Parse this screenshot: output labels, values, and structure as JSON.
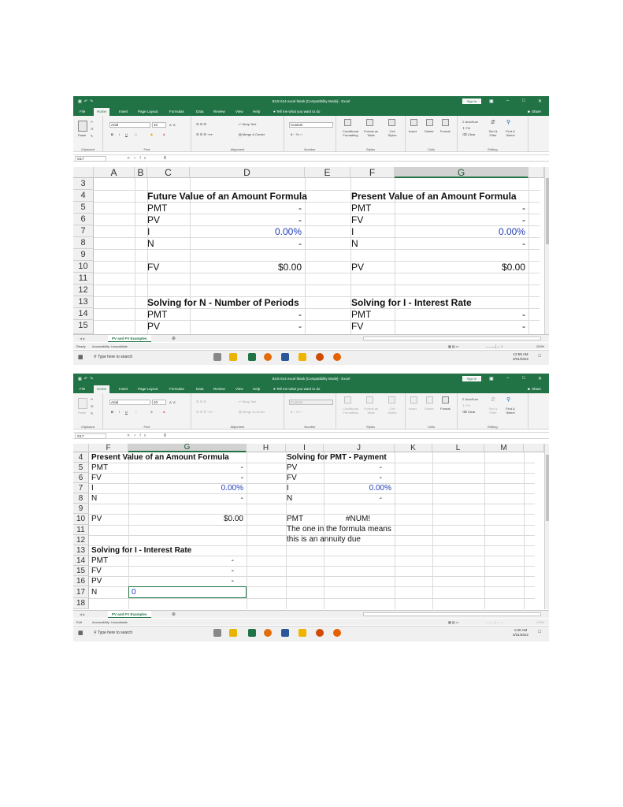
{
  "excel": {
    "title": "BUS 614 excel blank [Compatibility Mode] - Excel",
    "sign_in": "Sign in",
    "tabs": [
      "File",
      "Home",
      "Insert",
      "Page Layout",
      "Formulas",
      "Data",
      "Review",
      "View",
      "Help"
    ],
    "tell_me": "Tell me what you want to do",
    "share": "Share",
    "ribbon": {
      "paste": "Paste",
      "font_name": "Arial",
      "font_size": "10",
      "wrap_text": "Wrap Text",
      "merge_center": "Merge & Center",
      "number_format": "Custom",
      "conditional_formatting": "Conditional Formatting",
      "format_as_table": "Format as Table",
      "cell_styles": "Cell Styles",
      "insert": "Insert",
      "delete": "Delete",
      "format": "Format",
      "autosum": "AutoSum",
      "fill": "Fill",
      "clear": "Clear",
      "sort_filter": "Sort & Filter",
      "find_select": "Find & Select",
      "groups": [
        "Clipboard",
        "Font",
        "Alignment",
        "Number",
        "Styles",
        "Cells",
        "Editing"
      ]
    },
    "sheet_tab": "PV and FV Examples",
    "accessibility": "Accessibility: Unavailable",
    "taskbar_search": "Type here to search",
    "icons": [
      "save-icon",
      "undo-icon",
      "redo-icon",
      "minimize-icon",
      "restore-icon",
      "close-icon",
      "windows-start-icon",
      "search-icon",
      "task-view-icon",
      "file-explorer-icon",
      "excel-icon",
      "chrome-icon",
      "word-icon",
      "powerpoint-icon",
      "firefox-icon",
      "notification-icon"
    ]
  },
  "shot1": {
    "name_box": "G17",
    "formula": "0",
    "columns": [
      "A",
      "B",
      "C",
      "D",
      "E",
      "F",
      "G"
    ],
    "rows": [
      "3",
      "4",
      "5",
      "6",
      "7",
      "8",
      "9",
      "10",
      "11",
      "12",
      "13",
      "14",
      "15"
    ],
    "left_block": {
      "title": "Future Value of an Amount Formula",
      "labels": [
        "PMT",
        "PV",
        "I",
        "N",
        "FV"
      ],
      "values": [
        "-",
        "-",
        "0.00%",
        "-",
        "$0.00"
      ]
    },
    "right_block": {
      "title": "Present Value of an Amount Formula",
      "labels": [
        "PMT",
        "FV",
        "I",
        "N",
        "PV"
      ],
      "values": [
        "-",
        "-",
        "0.00%",
        "-",
        "$0.00"
      ]
    },
    "left_block2": {
      "title": "Solving for N - Number of Periods",
      "labels": [
        "PMT",
        "PV"
      ]
    },
    "right_block2": {
      "title": "Solving for I - Interest Rate",
      "labels": [
        "PMT",
        "FV"
      ],
      "values": [
        "-",
        "-"
      ]
    },
    "status": "Ready",
    "zoom": "200%",
    "time": "12:59 AM",
    "date": "3/31/2022"
  },
  "shot2": {
    "name_box": "G17",
    "formula": "0",
    "columns": [
      "F",
      "G",
      "H",
      "I",
      "J",
      "K",
      "L",
      "M"
    ],
    "rows": [
      "4",
      "5",
      "6",
      "7",
      "8",
      "9",
      "10",
      "11",
      "12",
      "13",
      "14",
      "15",
      "16",
      "17",
      "18"
    ],
    "pv_block": {
      "title": "Present Value of an Amount Formula",
      "labels": [
        "PMT",
        "FV",
        "I",
        "N",
        "PV"
      ],
      "values": [
        "-",
        "-",
        "0.00%",
        "-",
        "$0.00"
      ]
    },
    "pmt_block": {
      "title": "Solving for PMT - Payment",
      "labels": [
        "PV",
        "FV",
        "I",
        "N",
        "PMT"
      ],
      "values": [
        "-",
        "-",
        "0.00%",
        "-",
        "#NUM!"
      ]
    },
    "note": [
      "The one in the formula means",
      "this is an annuity due"
    ],
    "i_block": {
      "title": "Solving for I - Interest Rate",
      "labels": [
        "PMT",
        "FV",
        "PV",
        "N"
      ],
      "values": [
        "-",
        "-",
        "-",
        "0"
      ]
    },
    "status": "Edit",
    "zoom": "175%",
    "time": "1:00 AM",
    "date": "3/31/2022"
  }
}
